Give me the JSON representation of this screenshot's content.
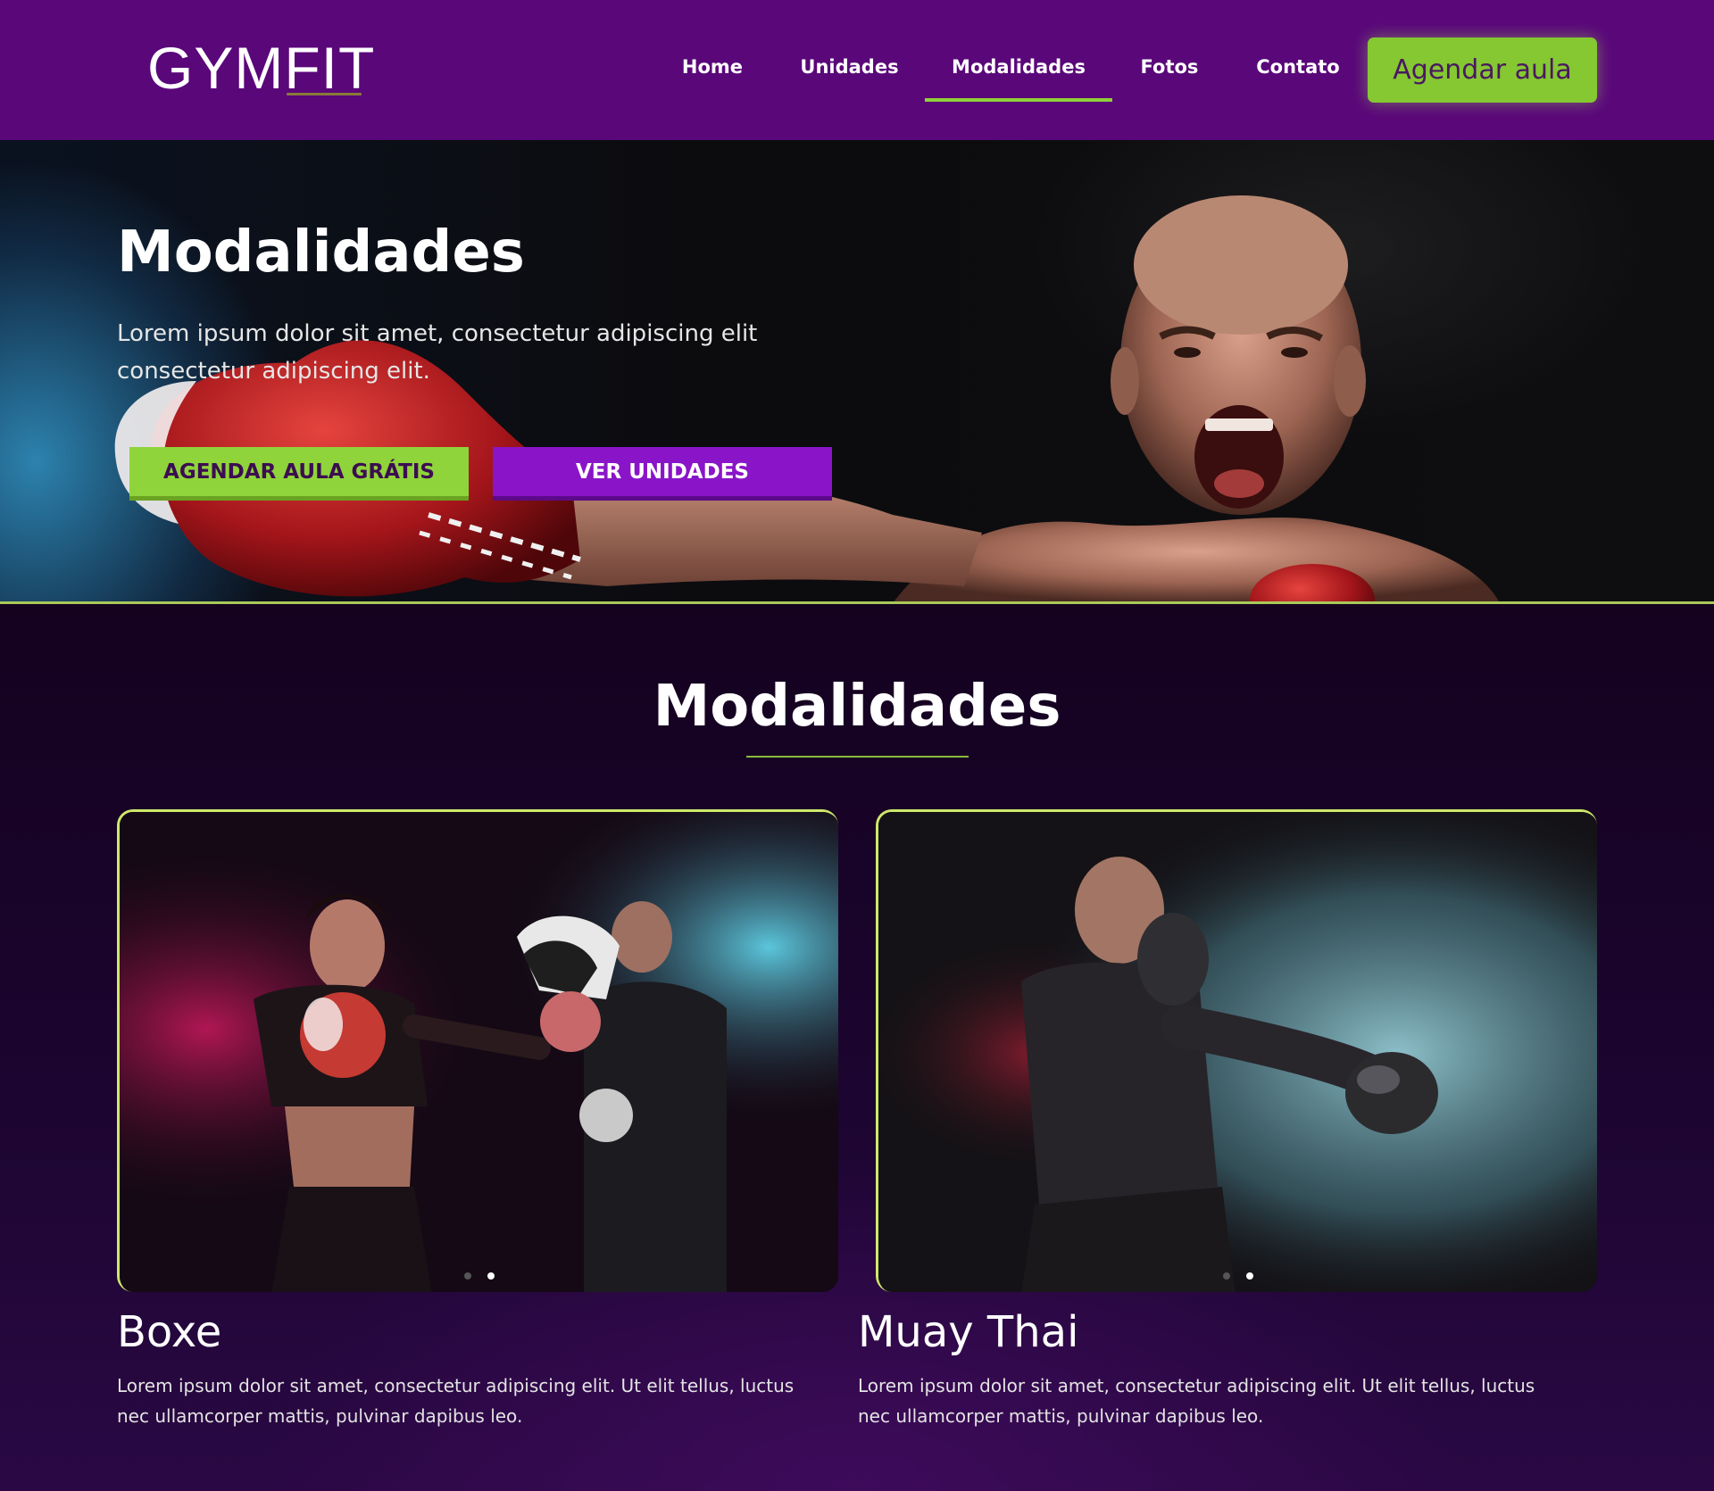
{
  "brand": {
    "logo": "GYMFIT"
  },
  "nav": {
    "items": [
      {
        "label": "Home"
      },
      {
        "label": "Unidades"
      },
      {
        "label": "Modalidades"
      },
      {
        "label": "Fotos"
      },
      {
        "label": "Contato"
      }
    ],
    "active": "Modalidades",
    "cta": "Agendar aula"
  },
  "hero": {
    "title": "Modalidades",
    "text": "Lorem ipsum dolor sit amet, consectetur adipiscing elit consectetur adipiscing elit.",
    "primary_button": "AGENDAR AULA GRÁTIS",
    "secondary_button": "VER UNIDADES"
  },
  "section": {
    "title": "Modalidades",
    "cards": [
      {
        "title": "Boxe",
        "text": "Lorem ipsum dolor sit amet, consectetur adipiscing elit. Ut elit tellus, luctus nec ullamcorper mattis, pulvinar dapibus leo.",
        "slides": 2,
        "active_slide": 2
      },
      {
        "title": "Muay Thai",
        "text": "Lorem ipsum dolor sit amet, consectetur adipiscing elit. Ut elit tellus, luctus nec ullamcorper mattis, pulvinar dapibus leo.",
        "slides": 2,
        "active_slide": 2
      }
    ]
  },
  "colors": {
    "nav_bg": "#5a077a",
    "accent_green": "#8fd43a",
    "accent_purple": "#8a14c8",
    "page_bg": "#13031e"
  }
}
